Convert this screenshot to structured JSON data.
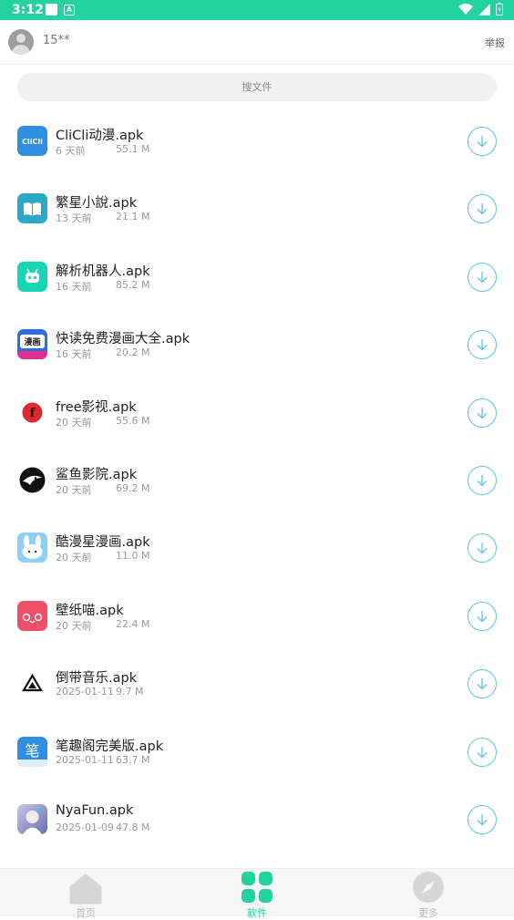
{
  "status_bar": {
    "time": "3:12"
  },
  "header": {
    "username": "15**",
    "report_label": "举报"
  },
  "search": {
    "placeholder": "搜文件"
  },
  "files": [
    {
      "name": "CliCli动漫.apk",
      "date": "6 天前",
      "size": "55.1 M",
      "icon": "clicli-icon"
    },
    {
      "name": "繁星小說.apk",
      "date": "13 天前",
      "size": "21.1 M",
      "icon": "book-icon"
    },
    {
      "name": "解析机器人.apk",
      "date": "16 天前",
      "size": "85.2 M",
      "icon": "robot-icon"
    },
    {
      "name": "快读免费漫画大全.apk",
      "date": "16 天前",
      "size": "20.2 M",
      "icon": "manga-icon"
    },
    {
      "name": "free影视.apk",
      "date": "20 天前",
      "size": "55.6 M",
      "icon": "free-film-icon"
    },
    {
      "name": "鲨鱼影院.apk",
      "date": "20 天前",
      "size": "69.2 M",
      "icon": "shark-icon"
    },
    {
      "name": "酷漫星漫画.apk",
      "date": "20 天前",
      "size": "11.0 M",
      "icon": "rabbit-icon"
    },
    {
      "name": "壁纸喵.apk",
      "date": "20 天前",
      "size": "22.4 M",
      "icon": "cat-face-icon"
    },
    {
      "name": "倒带音乐.apk",
      "date": "2025-01-11",
      "size": "9.7 M",
      "icon": "rewind-triangle-icon"
    },
    {
      "name": "笔趣阁完美版.apk",
      "date": "2025-01-11",
      "size": "63.7 M",
      "icon": "pen-char-icon"
    },
    {
      "name": "NyaFun.apk",
      "date": "2025-01-09",
      "size": "47.8 M",
      "icon": "anime-girl-icon"
    }
  ],
  "tabs": [
    {
      "label": "首页",
      "icon": "home-icon",
      "active": false
    },
    {
      "label": "软件",
      "icon": "apps-grid-icon",
      "active": true
    },
    {
      "label": "更多",
      "icon": "compass-icon",
      "active": false
    }
  ],
  "colors": {
    "accent": "#22d3a0",
    "download_ring": "#5ec4e0"
  }
}
